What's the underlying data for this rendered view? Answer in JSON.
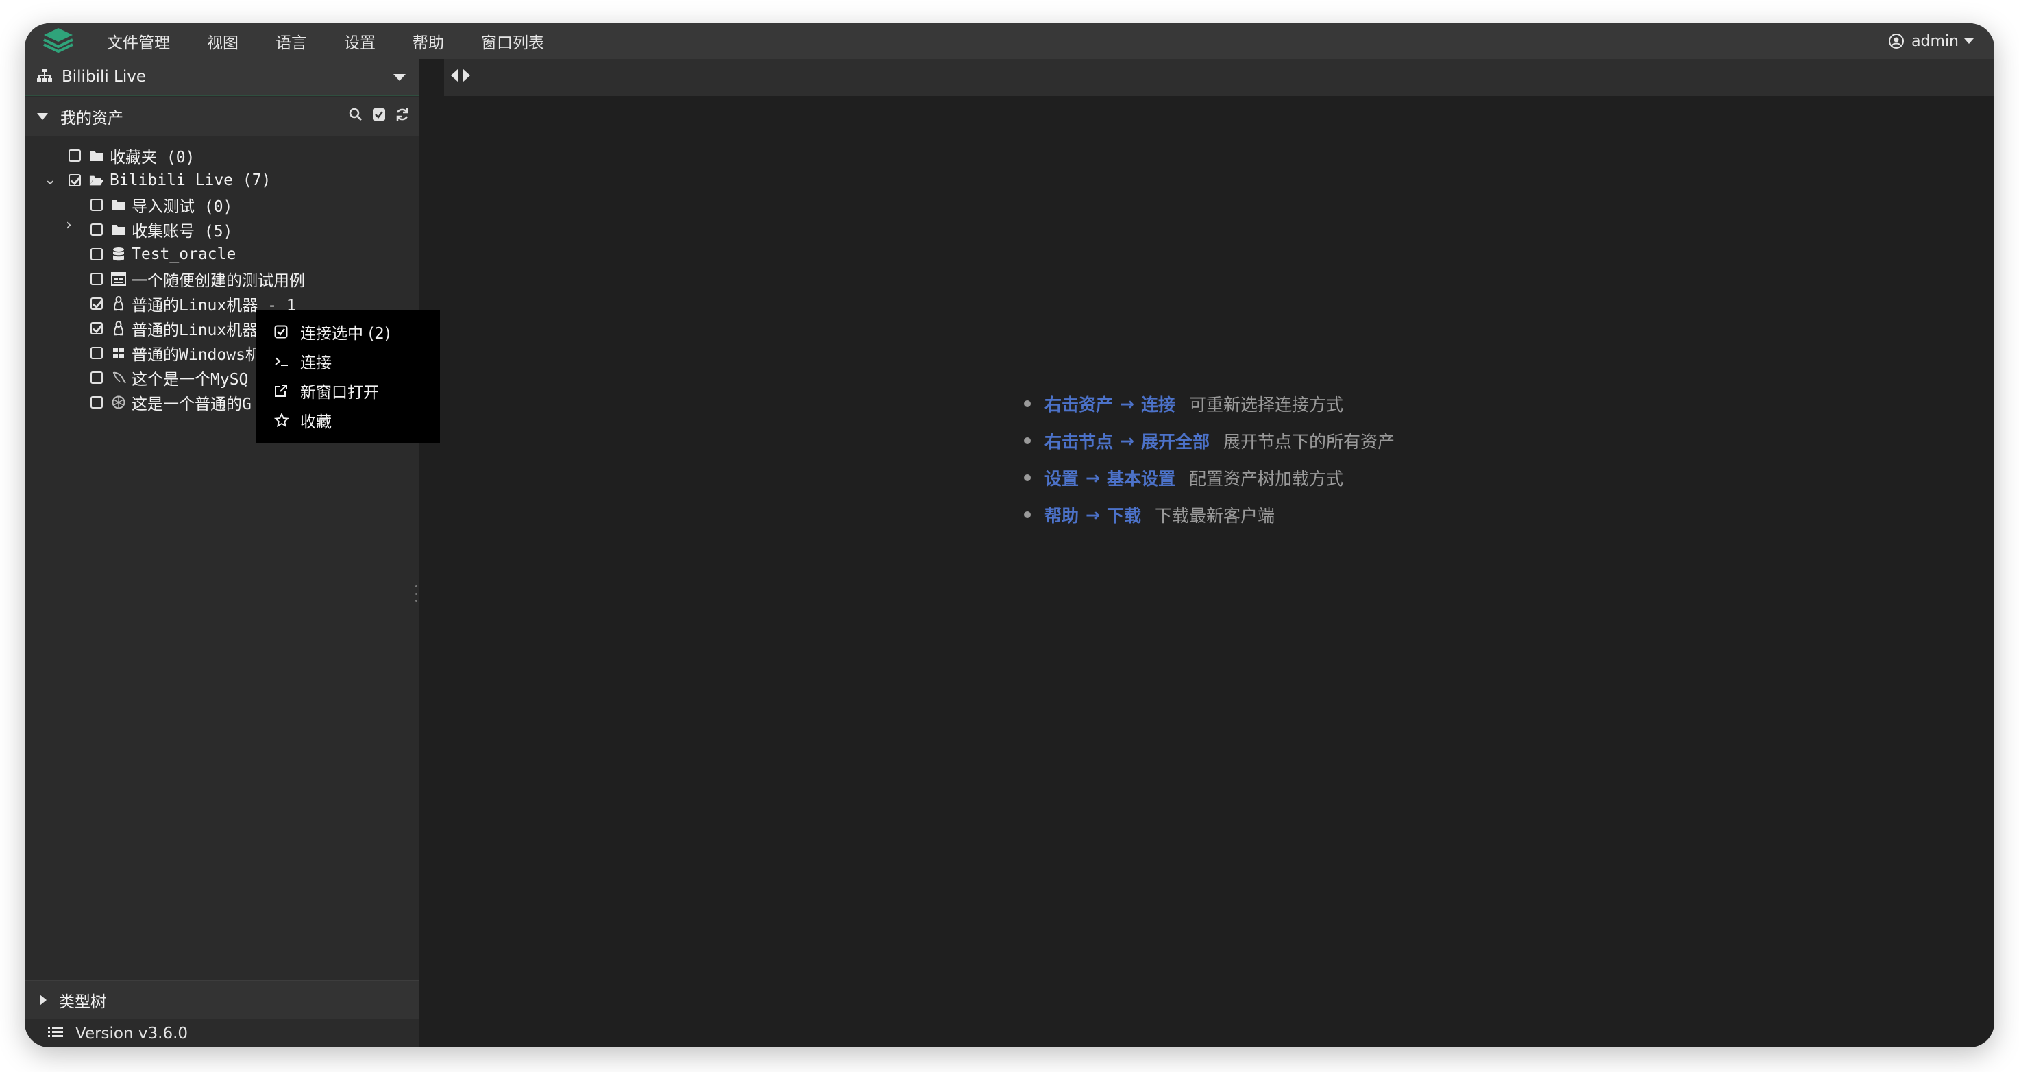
{
  "menubar": {
    "items": [
      "文件管理",
      "视图",
      "语言",
      "设置",
      "帮助",
      "窗口列表"
    ],
    "user": "admin"
  },
  "sidebar": {
    "org": "Bilibili Live",
    "section_title": "我的资产",
    "tree": [
      {
        "label": "收藏夹 (0)",
        "type": "folder",
        "checked": false
      },
      {
        "label": "Bilibili Live (7)",
        "type": "folder-open",
        "checked": true
      },
      {
        "label": "导入测试 (0)",
        "type": "folder",
        "checked": false
      },
      {
        "label": "收集账号 (5)",
        "type": "folder",
        "checked": false
      },
      {
        "label": "Test_oracle",
        "type": "database",
        "checked": false
      },
      {
        "label": "一个随便创建的测试用例",
        "type": "web",
        "checked": false
      },
      {
        "label": "普通的Linux机器 - 1",
        "type": "linux",
        "checked": true
      },
      {
        "label": "普通的Linux机器",
        "type": "linux",
        "checked": true
      },
      {
        "label": "普通的Windows机",
        "type": "windows",
        "checked": false
      },
      {
        "label": "这个是一个MySQ",
        "type": "mysql",
        "checked": false
      },
      {
        "label": "这是一个普通的G",
        "type": "gpt",
        "checked": false
      }
    ],
    "type_tree_label": "类型树",
    "version": "Version v3.6.0"
  },
  "context_menu": {
    "items": [
      "连接选中 (2)",
      "连接",
      "新窗口打开",
      "收藏"
    ]
  },
  "tips": [
    {
      "a": "右击资产",
      "b": "连接",
      "desc": "可重新选择连接方式"
    },
    {
      "a": "右击节点",
      "b": "展开全部",
      "desc": "展开节点下的所有资产"
    },
    {
      "a": "设置",
      "b": "基本设置",
      "desc": "配置资产树加载方式"
    },
    {
      "a": "帮助",
      "b": "下载",
      "desc": "下载最新客户端"
    }
  ],
  "colors": {
    "accent_link": "#4c72c9",
    "logo_green": "#2fa37a",
    "background": "#1f1f1f"
  }
}
